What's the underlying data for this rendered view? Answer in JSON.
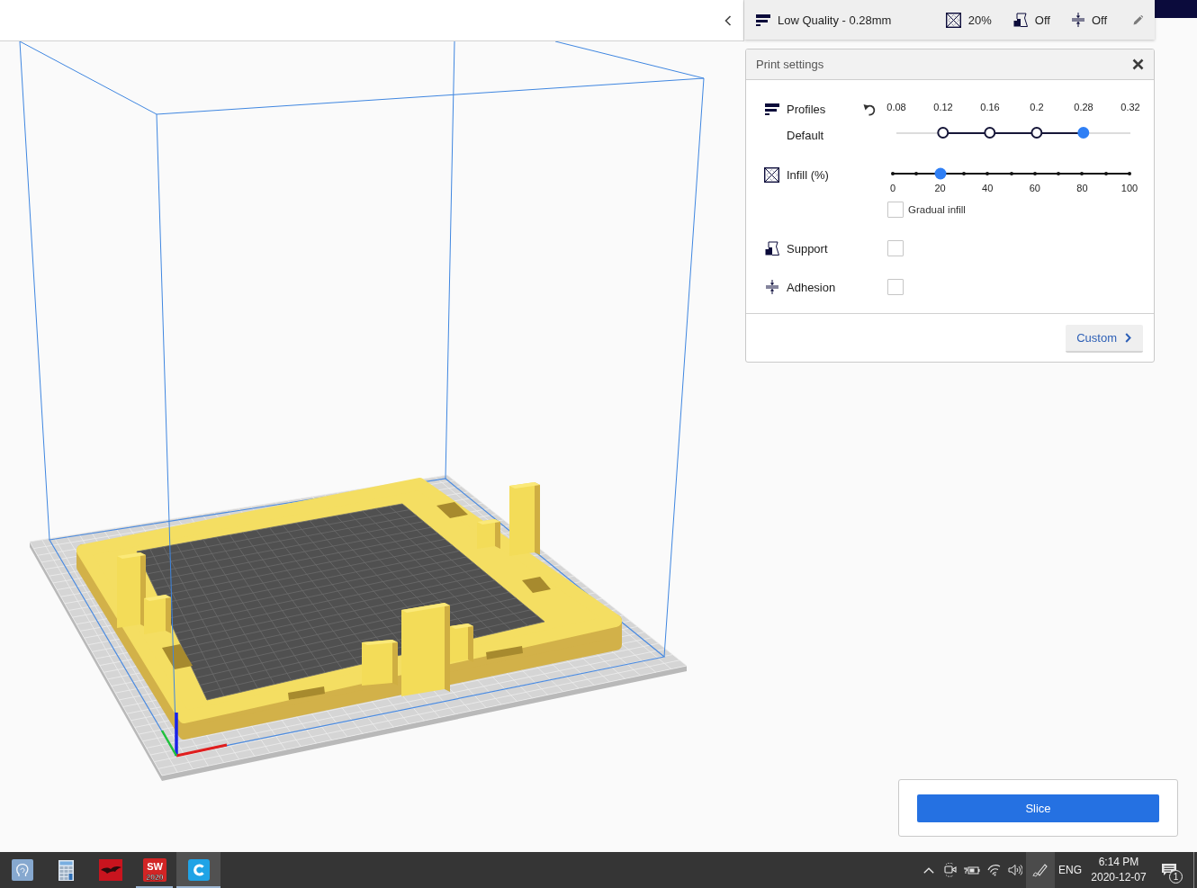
{
  "summary_bar": {
    "items": [
      {
        "kind": "profile",
        "text": "Low Quality - 0.28mm"
      },
      {
        "kind": "infill",
        "text": "20%"
      },
      {
        "kind": "support",
        "text": "Off"
      },
      {
        "kind": "adhesion",
        "text": "Off"
      }
    ]
  },
  "print_settings": {
    "title": "Print settings",
    "profiles": {
      "label": "Profiles",
      "profile": "Default",
      "layer_heights": [
        {
          "label": "0.08",
          "available": false,
          "selected": false
        },
        {
          "label": "0.12",
          "available": true,
          "selected": false
        },
        {
          "label": "0.16",
          "available": true,
          "selected": false
        },
        {
          "label": "0.2",
          "available": true,
          "selected": false
        },
        {
          "label": "0.28",
          "available": true,
          "selected": true
        },
        {
          "label": "0.32",
          "available": false,
          "selected": false
        }
      ]
    },
    "infill": {
      "label": "Infill (%)",
      "level": 0.2,
      "ticks": [
        "0",
        "20",
        "40",
        "60",
        "80",
        "100"
      ],
      "gradual": {
        "label": "Gradual infill",
        "checked": false
      }
    },
    "options": [
      {
        "kind": "support",
        "label": "Support",
        "checked": false
      },
      {
        "kind": "adhesion",
        "label": "Adhesion",
        "checked": false
      }
    ],
    "custom_button": "Custom"
  },
  "slice_panel": {
    "button": "Slice"
  },
  "taskbar": {
    "apps": [
      {
        "kind": "head",
        "running": false,
        "selected": false
      },
      {
        "kind": "calculator",
        "running": false,
        "selected": false
      },
      {
        "kind": "creature",
        "running": false,
        "selected": false
      },
      {
        "kind": "badge",
        "logo_text": "SW",
        "logo_year": "2020",
        "running": true,
        "selected": false
      },
      {
        "kind": "letter",
        "running": true,
        "selected": true
      }
    ],
    "tray": [
      {
        "kind": "chevron",
        "selected": false
      },
      {
        "kind": "camera",
        "selected": false
      },
      {
        "kind": "battery",
        "selected": false
      },
      {
        "kind": "wifi",
        "selected": false
      },
      {
        "kind": "speaker",
        "selected": false
      },
      {
        "kind": "pen",
        "selected": true
      }
    ],
    "language": "ENG",
    "time": "6:14 PM",
    "date": "2020-12-07",
    "notification_count": "1"
  }
}
